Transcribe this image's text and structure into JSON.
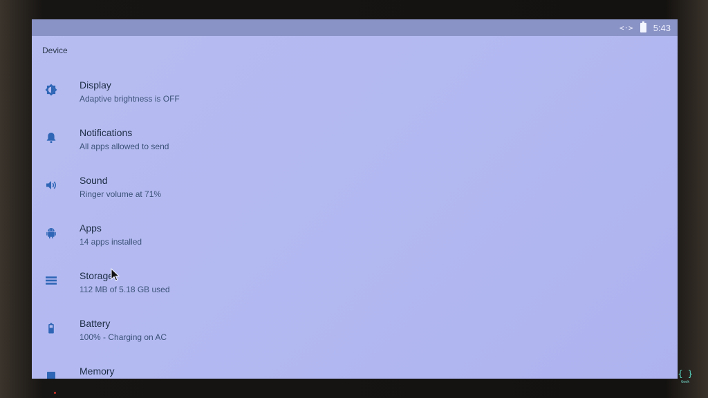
{
  "status_bar": {
    "time": "5:43",
    "icons": [
      "developer-icon",
      "battery-icon"
    ]
  },
  "section": {
    "title": "Device"
  },
  "settings": [
    {
      "icon": "display-brightness-icon",
      "title": "Display",
      "summary": "Adaptive brightness is OFF"
    },
    {
      "icon": "bell-icon",
      "title": "Notifications",
      "summary": "All apps allowed to send"
    },
    {
      "icon": "volume-icon",
      "title": "Sound",
      "summary": "Ringer volume at 71%"
    },
    {
      "icon": "android-icon",
      "title": "Apps",
      "summary": "14 apps installed"
    },
    {
      "icon": "storage-icon",
      "title": "Storage",
      "summary": "112 MB of 5.18 GB used"
    },
    {
      "icon": "battery-icon",
      "title": "Battery",
      "summary": "100% - Charging on AC"
    },
    {
      "icon": "memory-icon",
      "title": "Memory",
      "summary": ""
    }
  ],
  "watermark": {
    "mark": "{ }",
    "text": "Geek"
  },
  "colors": {
    "accent": "#2f66b6",
    "screen_bg": "#b5bbf0",
    "status_bar": "#8a93c5"
  }
}
